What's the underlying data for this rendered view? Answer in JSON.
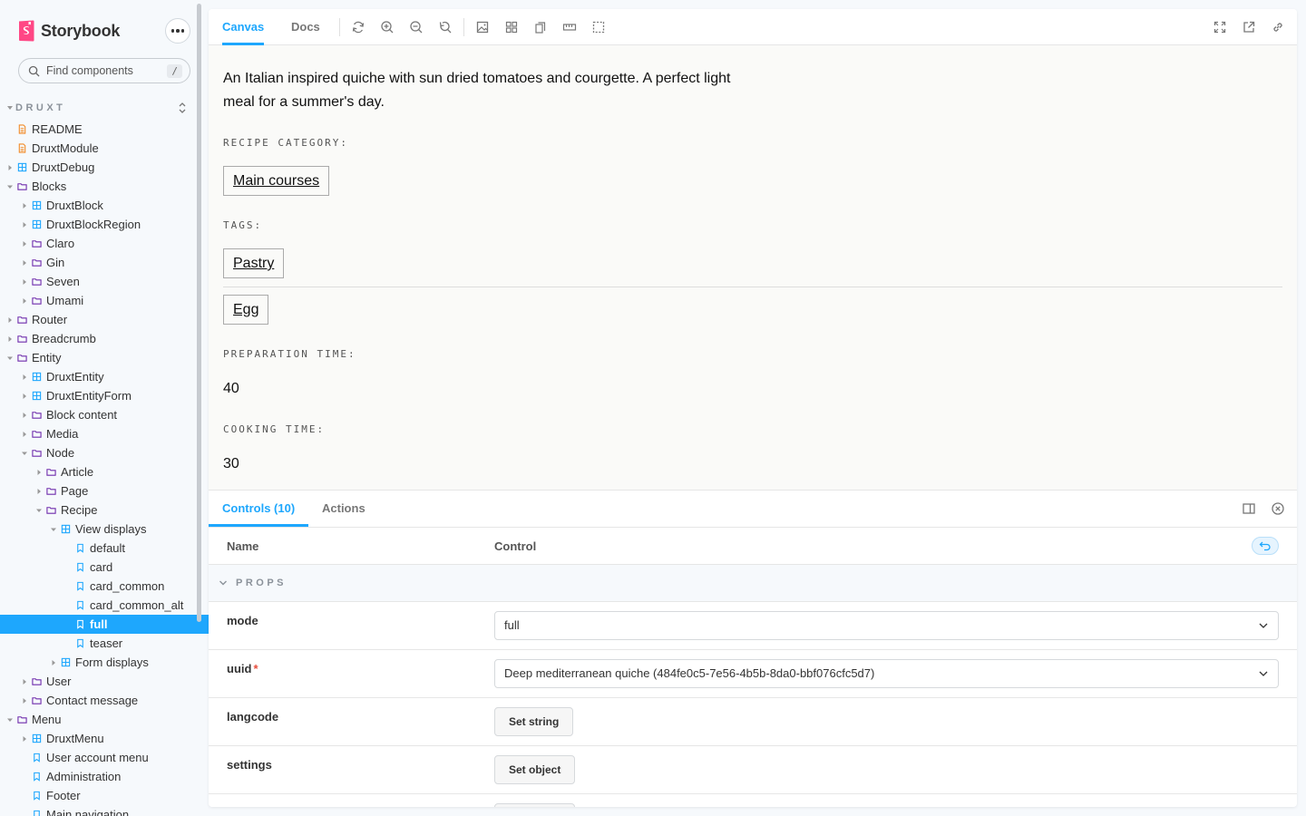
{
  "app": {
    "name": "Storybook",
    "accent": "#1ea7fd",
    "brand_color": "#ff4785"
  },
  "search": {
    "placeholder": "Find components",
    "shortcut": "/"
  },
  "sidebar": {
    "group": "DRUXT",
    "items": [
      {
        "label": "README",
        "type": "doc",
        "depth": 0,
        "toggle": "none"
      },
      {
        "label": "DruxtModule",
        "type": "doc",
        "depth": 0,
        "toggle": "none"
      },
      {
        "label": "DruxtDebug",
        "type": "component",
        "depth": 0,
        "toggle": "collapsed"
      },
      {
        "label": "Blocks",
        "type": "folder",
        "depth": 0,
        "toggle": "expanded"
      },
      {
        "label": "DruxtBlock",
        "type": "component",
        "depth": 1,
        "toggle": "collapsed"
      },
      {
        "label": "DruxtBlockRegion",
        "type": "component",
        "depth": 1,
        "toggle": "collapsed"
      },
      {
        "label": "Claro",
        "type": "folder",
        "depth": 1,
        "toggle": "collapsed"
      },
      {
        "label": "Gin",
        "type": "folder",
        "depth": 1,
        "toggle": "collapsed"
      },
      {
        "label": "Seven",
        "type": "folder",
        "depth": 1,
        "toggle": "collapsed"
      },
      {
        "label": "Umami",
        "type": "folder",
        "depth": 1,
        "toggle": "collapsed"
      },
      {
        "label": "Router",
        "type": "folder",
        "depth": 0,
        "toggle": "collapsed"
      },
      {
        "label": "Breadcrumb",
        "type": "folder",
        "depth": 0,
        "toggle": "collapsed"
      },
      {
        "label": "Entity",
        "type": "folder",
        "depth": 0,
        "toggle": "expanded"
      },
      {
        "label": "DruxtEntity",
        "type": "component",
        "depth": 1,
        "toggle": "collapsed"
      },
      {
        "label": "DruxtEntityForm",
        "type": "component",
        "depth": 1,
        "toggle": "collapsed"
      },
      {
        "label": "Block content",
        "type": "folder",
        "depth": 1,
        "toggle": "collapsed"
      },
      {
        "label": "Media",
        "type": "folder",
        "depth": 1,
        "toggle": "collapsed"
      },
      {
        "label": "Node",
        "type": "folder",
        "depth": 1,
        "toggle": "expanded"
      },
      {
        "label": "Article",
        "type": "folder",
        "depth": 2,
        "toggle": "collapsed"
      },
      {
        "label": "Page",
        "type": "folder",
        "depth": 2,
        "toggle": "collapsed"
      },
      {
        "label": "Recipe",
        "type": "folder",
        "depth": 2,
        "toggle": "expanded"
      },
      {
        "label": "View displays",
        "type": "component",
        "depth": 3,
        "toggle": "expanded"
      },
      {
        "label": "default",
        "type": "story",
        "depth": 4,
        "toggle": "none"
      },
      {
        "label": "card",
        "type": "story",
        "depth": 4,
        "toggle": "none"
      },
      {
        "label": "card_common",
        "type": "story",
        "depth": 4,
        "toggle": "none"
      },
      {
        "label": "card_common_alt",
        "type": "story",
        "depth": 4,
        "toggle": "none"
      },
      {
        "label": "full",
        "type": "story",
        "depth": 4,
        "toggle": "none",
        "selected": true
      },
      {
        "label": "teaser",
        "type": "story",
        "depth": 4,
        "toggle": "none"
      },
      {
        "label": "Form displays",
        "type": "component",
        "depth": 3,
        "toggle": "collapsed"
      },
      {
        "label": "User",
        "type": "folder",
        "depth": 1,
        "toggle": "collapsed"
      },
      {
        "label": "Contact message",
        "type": "folder",
        "depth": 1,
        "toggle": "collapsed"
      },
      {
        "label": "Menu",
        "type": "folder",
        "depth": 0,
        "toggle": "expanded"
      },
      {
        "label": "DruxtMenu",
        "type": "component",
        "depth": 1,
        "toggle": "collapsed"
      },
      {
        "label": "User account menu",
        "type": "story",
        "depth": 1,
        "toggle": "none"
      },
      {
        "label": "Administration",
        "type": "story",
        "depth": 1,
        "toggle": "none"
      },
      {
        "label": "Footer",
        "type": "story",
        "depth": 1,
        "toggle": "none"
      },
      {
        "label": "Main navigation",
        "type": "story",
        "depth": 1,
        "toggle": "none"
      }
    ]
  },
  "toolbar": {
    "tabs": [
      "Canvas",
      "Docs"
    ],
    "tools": [
      "reload-icon",
      "zoom-in-icon",
      "zoom-out-icon",
      "zoom-reset-icon",
      "background-icon",
      "grid-icon",
      "viewport-icon",
      "measure-icon",
      "outline-icon"
    ],
    "right_tools": [
      "fullscreen-icon",
      "open-new-tab-icon",
      "copy-link-icon"
    ]
  },
  "canvas": {
    "description": "An Italian inspired quiche with sun dried tomatoes and courgette. A perfect light meal for a summer's day.",
    "category_label": "RECIPE CATEGORY:",
    "category": "Main courses",
    "tags_label": "TAGS:",
    "tags": [
      "Pastry",
      "Egg"
    ],
    "prep_label": "PREPARATION TIME:",
    "prep_value": "40",
    "cook_label": "COOKING TIME:",
    "cook_value": "30"
  },
  "addons": {
    "tabs": [
      "Controls (10)",
      "Actions"
    ],
    "col_name": "Name",
    "col_control": "Control",
    "section": "PROPS",
    "rows": {
      "mode": {
        "name": "mode",
        "value": "full"
      },
      "uuid": {
        "name": "uuid",
        "required": "*",
        "value": "Deep mediterranean quiche (484fe0c5-7e56-4b5b-8da0-bbf076cfc5d7)"
      },
      "langcode": {
        "name": "langcode",
        "button": "Set string"
      },
      "settings": {
        "name": "settings",
        "button": "Set object"
      }
    }
  }
}
